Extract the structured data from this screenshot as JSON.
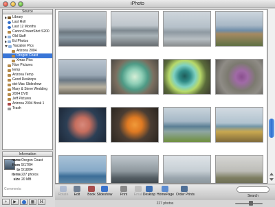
{
  "window": {
    "title": "iPhoto"
  },
  "source": {
    "header": "Source",
    "albums": [
      {
        "label": "Library",
        "icon": "library-icon",
        "indent": 0,
        "disclosure": "closed"
      },
      {
        "label": "Last Roll",
        "icon": "roll-icon",
        "indent": 0
      },
      {
        "label": "Last 12 Months",
        "icon": "calendar-icon",
        "indent": 0
      },
      {
        "label": "Canon PowerShot S200",
        "icon": "album-icon",
        "indent": 0
      },
      {
        "label": "Old Stuff",
        "icon": "folder-icon",
        "indent": 0,
        "disclosure": "closed"
      },
      {
        "label": "Ed Photos",
        "icon": "folder-icon",
        "indent": 0,
        "disclosure": "closed"
      },
      {
        "label": "Vacation Pics",
        "icon": "folder-icon",
        "indent": 0,
        "disclosure": "open"
      },
      {
        "label": "Arizona 2004",
        "icon": "album-icon",
        "indent": 1
      },
      {
        "label": "Oregon Coast",
        "icon": "album-icon",
        "indent": 1,
        "selected": true
      },
      {
        "label": "Xmas Pics",
        "icon": "album-icon",
        "indent": 1
      },
      {
        "label": "Nice Pictures",
        "icon": "album-icon",
        "indent": 0
      },
      {
        "label": "temp",
        "icon": "album-icon",
        "indent": 0
      },
      {
        "label": "Arizona Temp",
        "icon": "album-icon",
        "indent": 0
      },
      {
        "label": "Good Desktops",
        "icon": "album-icon",
        "indent": 0
      },
      {
        "label": "dot-Mac Slideshow",
        "icon": "album-icon",
        "indent": 0
      },
      {
        "label": "Mary & Steve Wedding",
        "icon": "album-icon",
        "indent": 0
      },
      {
        "label": "2004 DVD",
        "icon": "album-icon",
        "indent": 0
      },
      {
        "label": "Jeff Pictures",
        "icon": "album-icon",
        "indent": 0
      },
      {
        "label": "Arizona 2004 Book 1",
        "icon": "book-icon",
        "indent": 0
      },
      {
        "label": "Trash",
        "icon": "trash-icon",
        "indent": 0
      }
    ]
  },
  "information": {
    "header": "Information",
    "rows": [
      {
        "key": "name",
        "value": "Oregon Coast"
      },
      {
        "key": "from",
        "value": "5/17/04"
      },
      {
        "key": "to",
        "value": "5/18/04"
      },
      {
        "key": "items",
        "value": "227 photos"
      },
      {
        "key": "size",
        "value": "20 MB"
      }
    ],
    "comments_label": "Comments:"
  },
  "left_buttons": [
    {
      "name": "add-album-button",
      "glyph": "+"
    },
    {
      "name": "play-slideshow-button",
      "glyph": "▶"
    },
    {
      "name": "info-button",
      "glyph": "i"
    },
    {
      "name": "calendar-button",
      "glyph": "▦"
    },
    {
      "name": "keywords-button",
      "glyph": "⌘"
    }
  ],
  "toolbar": {
    "tools": [
      {
        "label": "Rotate",
        "icon": "rotate-icon",
        "enabled": false
      },
      {
        "label": "Edit",
        "icon": "edit-icon",
        "enabled": true
      },
      {
        "label": "Book",
        "icon": "book-icon",
        "enabled": true
      },
      {
        "label": "Slideshow",
        "icon": "slideshow-icon",
        "enabled": true
      },
      {
        "label": "Print",
        "icon": "print-icon",
        "enabled": true
      },
      {
        "label": "Email",
        "icon": "email-icon",
        "enabled": false
      },
      {
        "label": "Desktop",
        "icon": "desktop-icon",
        "enabled": true
      },
      {
        "label": "HomePage",
        "icon": "homepage-icon",
        "enabled": true
      },
      {
        "label": "Order Prints",
        "icon": "order-prints-icon",
        "enabled": true
      }
    ],
    "search_label": "Search",
    "search_value": ""
  },
  "status": {
    "photo_count": "227 photos"
  },
  "zoom": {
    "level": 0.6
  },
  "photos": [
    {
      "subject": "sea-stacks-mist"
    },
    {
      "subject": "beach-rocks"
    },
    {
      "subject": "rock-beach"
    },
    {
      "subject": "fence-ocean"
    },
    {
      "subject": "bird-rocks"
    },
    {
      "subject": "green-anemone"
    },
    {
      "subject": "teal-anemone"
    },
    {
      "subject": "purple-starfish"
    },
    {
      "subject": "orange-starfish-rocks"
    },
    {
      "subject": "orange-starfish"
    },
    {
      "subject": "coast-grass"
    },
    {
      "subject": "grass-rocks"
    },
    {
      "subject": "blue-sea-rock"
    },
    {
      "subject": "rocks-shadow"
    },
    {
      "subject": "fog-coast"
    },
    {
      "subject": "horse-field"
    }
  ],
  "colors": {
    "selection": "#3875d7",
    "scroll_knob": "#2e6fcf"
  }
}
